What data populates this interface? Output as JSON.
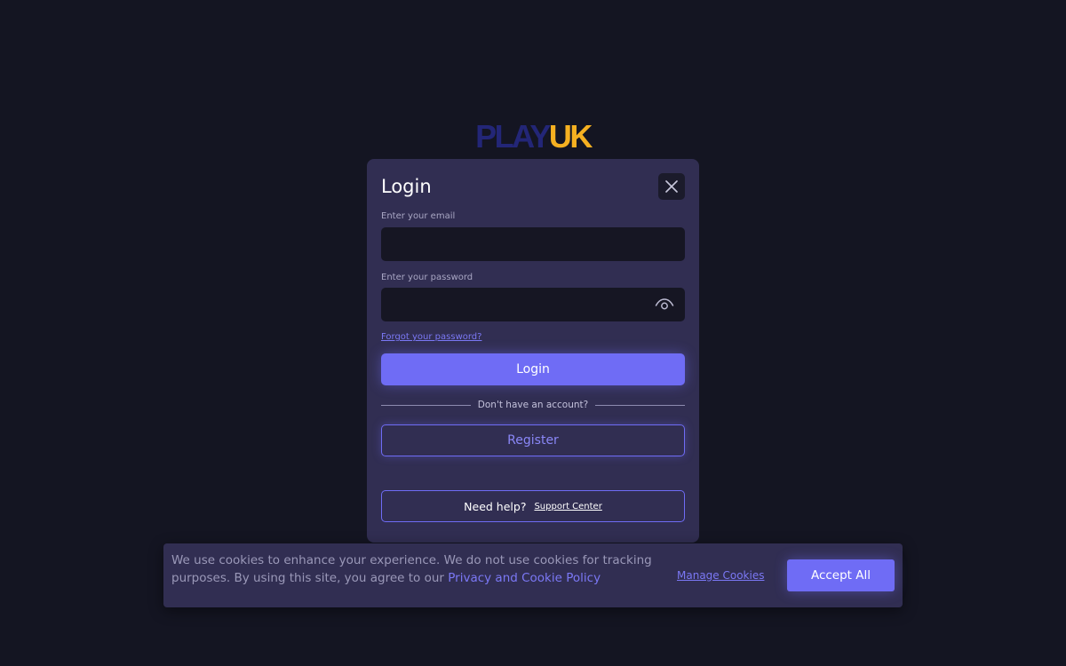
{
  "logo": {
    "part1": "PLAY",
    "part2": "UK",
    "colors": {
      "part1": "#232677",
      "part2": "#f5b021"
    }
  },
  "login_modal": {
    "title": "Login",
    "close_icon": "close-icon",
    "email": {
      "label": "Enter your email",
      "value": ""
    },
    "password": {
      "label": "Enter your password",
      "value": "",
      "toggle_icon": "eye-icon"
    },
    "forgot_link": "Forgot your password?",
    "login_button": "Login",
    "divider_text": "Don't have an account?",
    "register_button": "Register",
    "help": {
      "text": "Need help?",
      "link": "Support Center"
    }
  },
  "cookie_banner": {
    "text": "We use cookies to enhance your experience. We do not use cookies for tracking purposes. By using this site, you agree to our ",
    "policy_link": "Privacy and Cookie Policy",
    "manage_link": "Manage Cookies",
    "accept_button": "Accept All"
  },
  "colors": {
    "background": "#141522",
    "panel": "#312e52",
    "accent": "#6f6cf5",
    "input_bg": "#161623"
  }
}
